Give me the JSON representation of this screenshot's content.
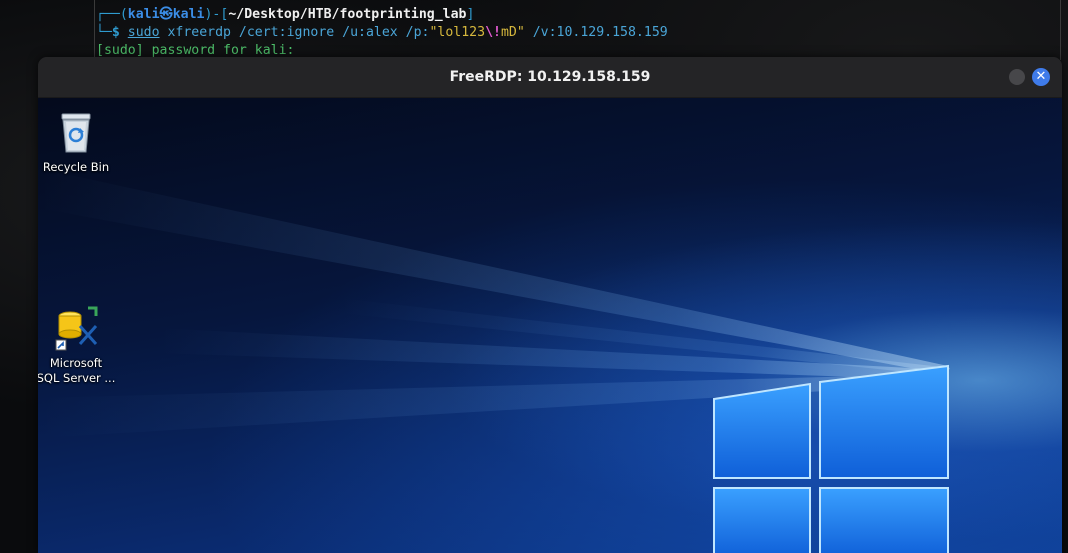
{
  "terminal": {
    "line1": {
      "open": "┌──(",
      "user": "kali㉿kali",
      "mid": ")-[",
      "path": "~/Desktop/HTB/footprinting_lab",
      "close": "]"
    },
    "line2": {
      "prompt": "└─$ ",
      "sudo": "sudo",
      "cmd_part1": " xfreerdp /cert:ignore /u:alex /p:",
      "str_open": "\"lol123",
      "escape": "\\!",
      "str_close": "mD\"",
      "cmd_part2": " /v:10.129.158.159"
    },
    "line3": "[sudo] password for kali:"
  },
  "rdp_window": {
    "title": "FreeRDP: 10.129.158.159",
    "close_glyph": "✕"
  },
  "desktop": {
    "icons": [
      {
        "label_line1": "Recycle Bin",
        "icon": "recycle-bin-icon"
      },
      {
        "label_line1": "Microsoft",
        "label_line2": "SQL Server ...",
        "icon": "sql-server-icon"
      }
    ]
  },
  "colors": {
    "close_button": "#3f7bea",
    "titlebar": "#242426",
    "desktop_blue": "#0c3a8c"
  }
}
